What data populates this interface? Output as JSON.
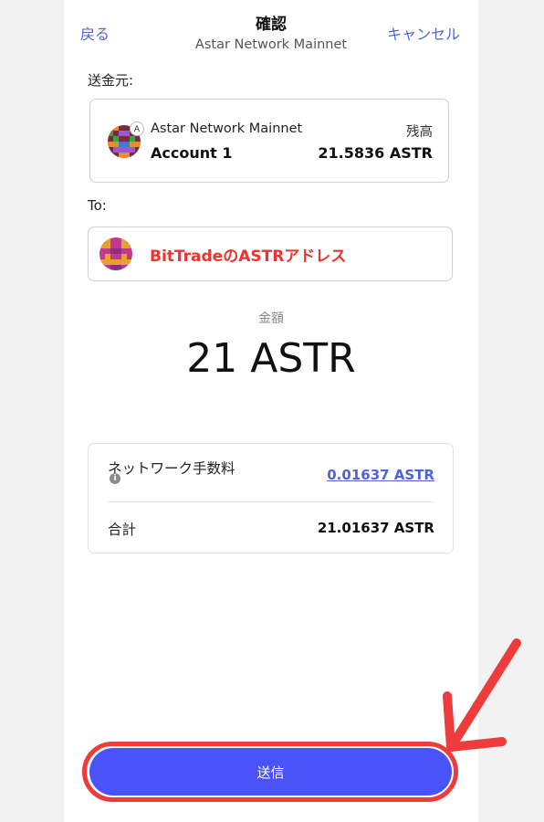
{
  "header": {
    "back_label": "戻る",
    "title": "確認",
    "subtitle": "Astar Network Mainnet",
    "cancel_label": "キャンセル"
  },
  "from": {
    "section_label": "送金元:",
    "network_badge": "A",
    "network_name": "Astar Network Mainnet",
    "account_name": "Account 1",
    "balance_label": "残高",
    "balance_value": "21.5836 ASTR"
  },
  "to": {
    "section_label": "To:",
    "recipient_name": "BitTradeのASTRアドレス"
  },
  "amount": {
    "label": "金額",
    "value": "21 ASTR"
  },
  "fees": {
    "network_fee_label": "ネットワーク手数料",
    "network_fee_value": "0.01637 ASTR",
    "info_icon": "i",
    "total_label": "合計",
    "total_value": "21.01637 ASTR"
  },
  "actions": {
    "send_label": "送信"
  },
  "colors": {
    "accent": "#4e63d6",
    "send_button": "#4a52fa",
    "highlight_red": "#ee3b3b",
    "recipient_text": "#f0332e"
  },
  "icons": {
    "from_avatar": "account-identicon",
    "to_avatar": "recipient-identicon",
    "annotation_arrow": "red-arrow-icon"
  }
}
